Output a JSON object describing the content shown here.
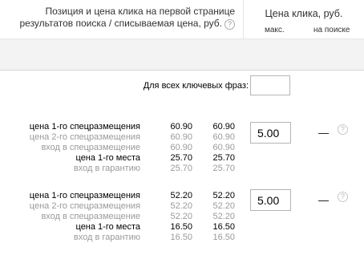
{
  "header": {
    "left_line1": "Позиция и цена клика на первой странице",
    "left_line2": "результатов поиска / списываемая цена, руб.",
    "help_glyph": "?",
    "right_title": "Цена клика, руб.",
    "col_max": "макс.",
    "col_search": "на поиске"
  },
  "all_phrases": {
    "label": "Для всех ключевых фраз:",
    "value": ""
  },
  "blocks": [
    {
      "rows": [
        {
          "label": "цена 1-го спецразмещения",
          "v1": "60.90",
          "v2": "60.90"
        },
        {
          "label": "цена 2-го спецразмещения",
          "v1": "60.90",
          "v2": "60.90"
        },
        {
          "label": "вход в спецразмещение",
          "v1": "60.90",
          "v2": "60.90"
        },
        {
          "label": "цена 1-го места",
          "v1": "25.70",
          "v2": "25.70"
        },
        {
          "label": "вход в гарантию",
          "v1": "25.70",
          "v2": "25.70"
        }
      ],
      "max_price": "5.00",
      "search_price": "—",
      "help_glyph": "?"
    },
    {
      "rows": [
        {
          "label": "цена 1-го спецразмещения",
          "v1": "52.20",
          "v2": "52.20"
        },
        {
          "label": "цена 2-го спецразмещения",
          "v1": "52.20",
          "v2": "52.20"
        },
        {
          "label": "вход в спецразмещение",
          "v1": "52.20",
          "v2": "52.20"
        },
        {
          "label": "цена 1-го места",
          "v1": "16.50",
          "v2": "16.50"
        },
        {
          "label": "вход в гарантию",
          "v1": "16.50",
          "v2": "16.50"
        }
      ],
      "max_price": "5.00",
      "search_price": "—",
      "help_glyph": "?"
    }
  ]
}
